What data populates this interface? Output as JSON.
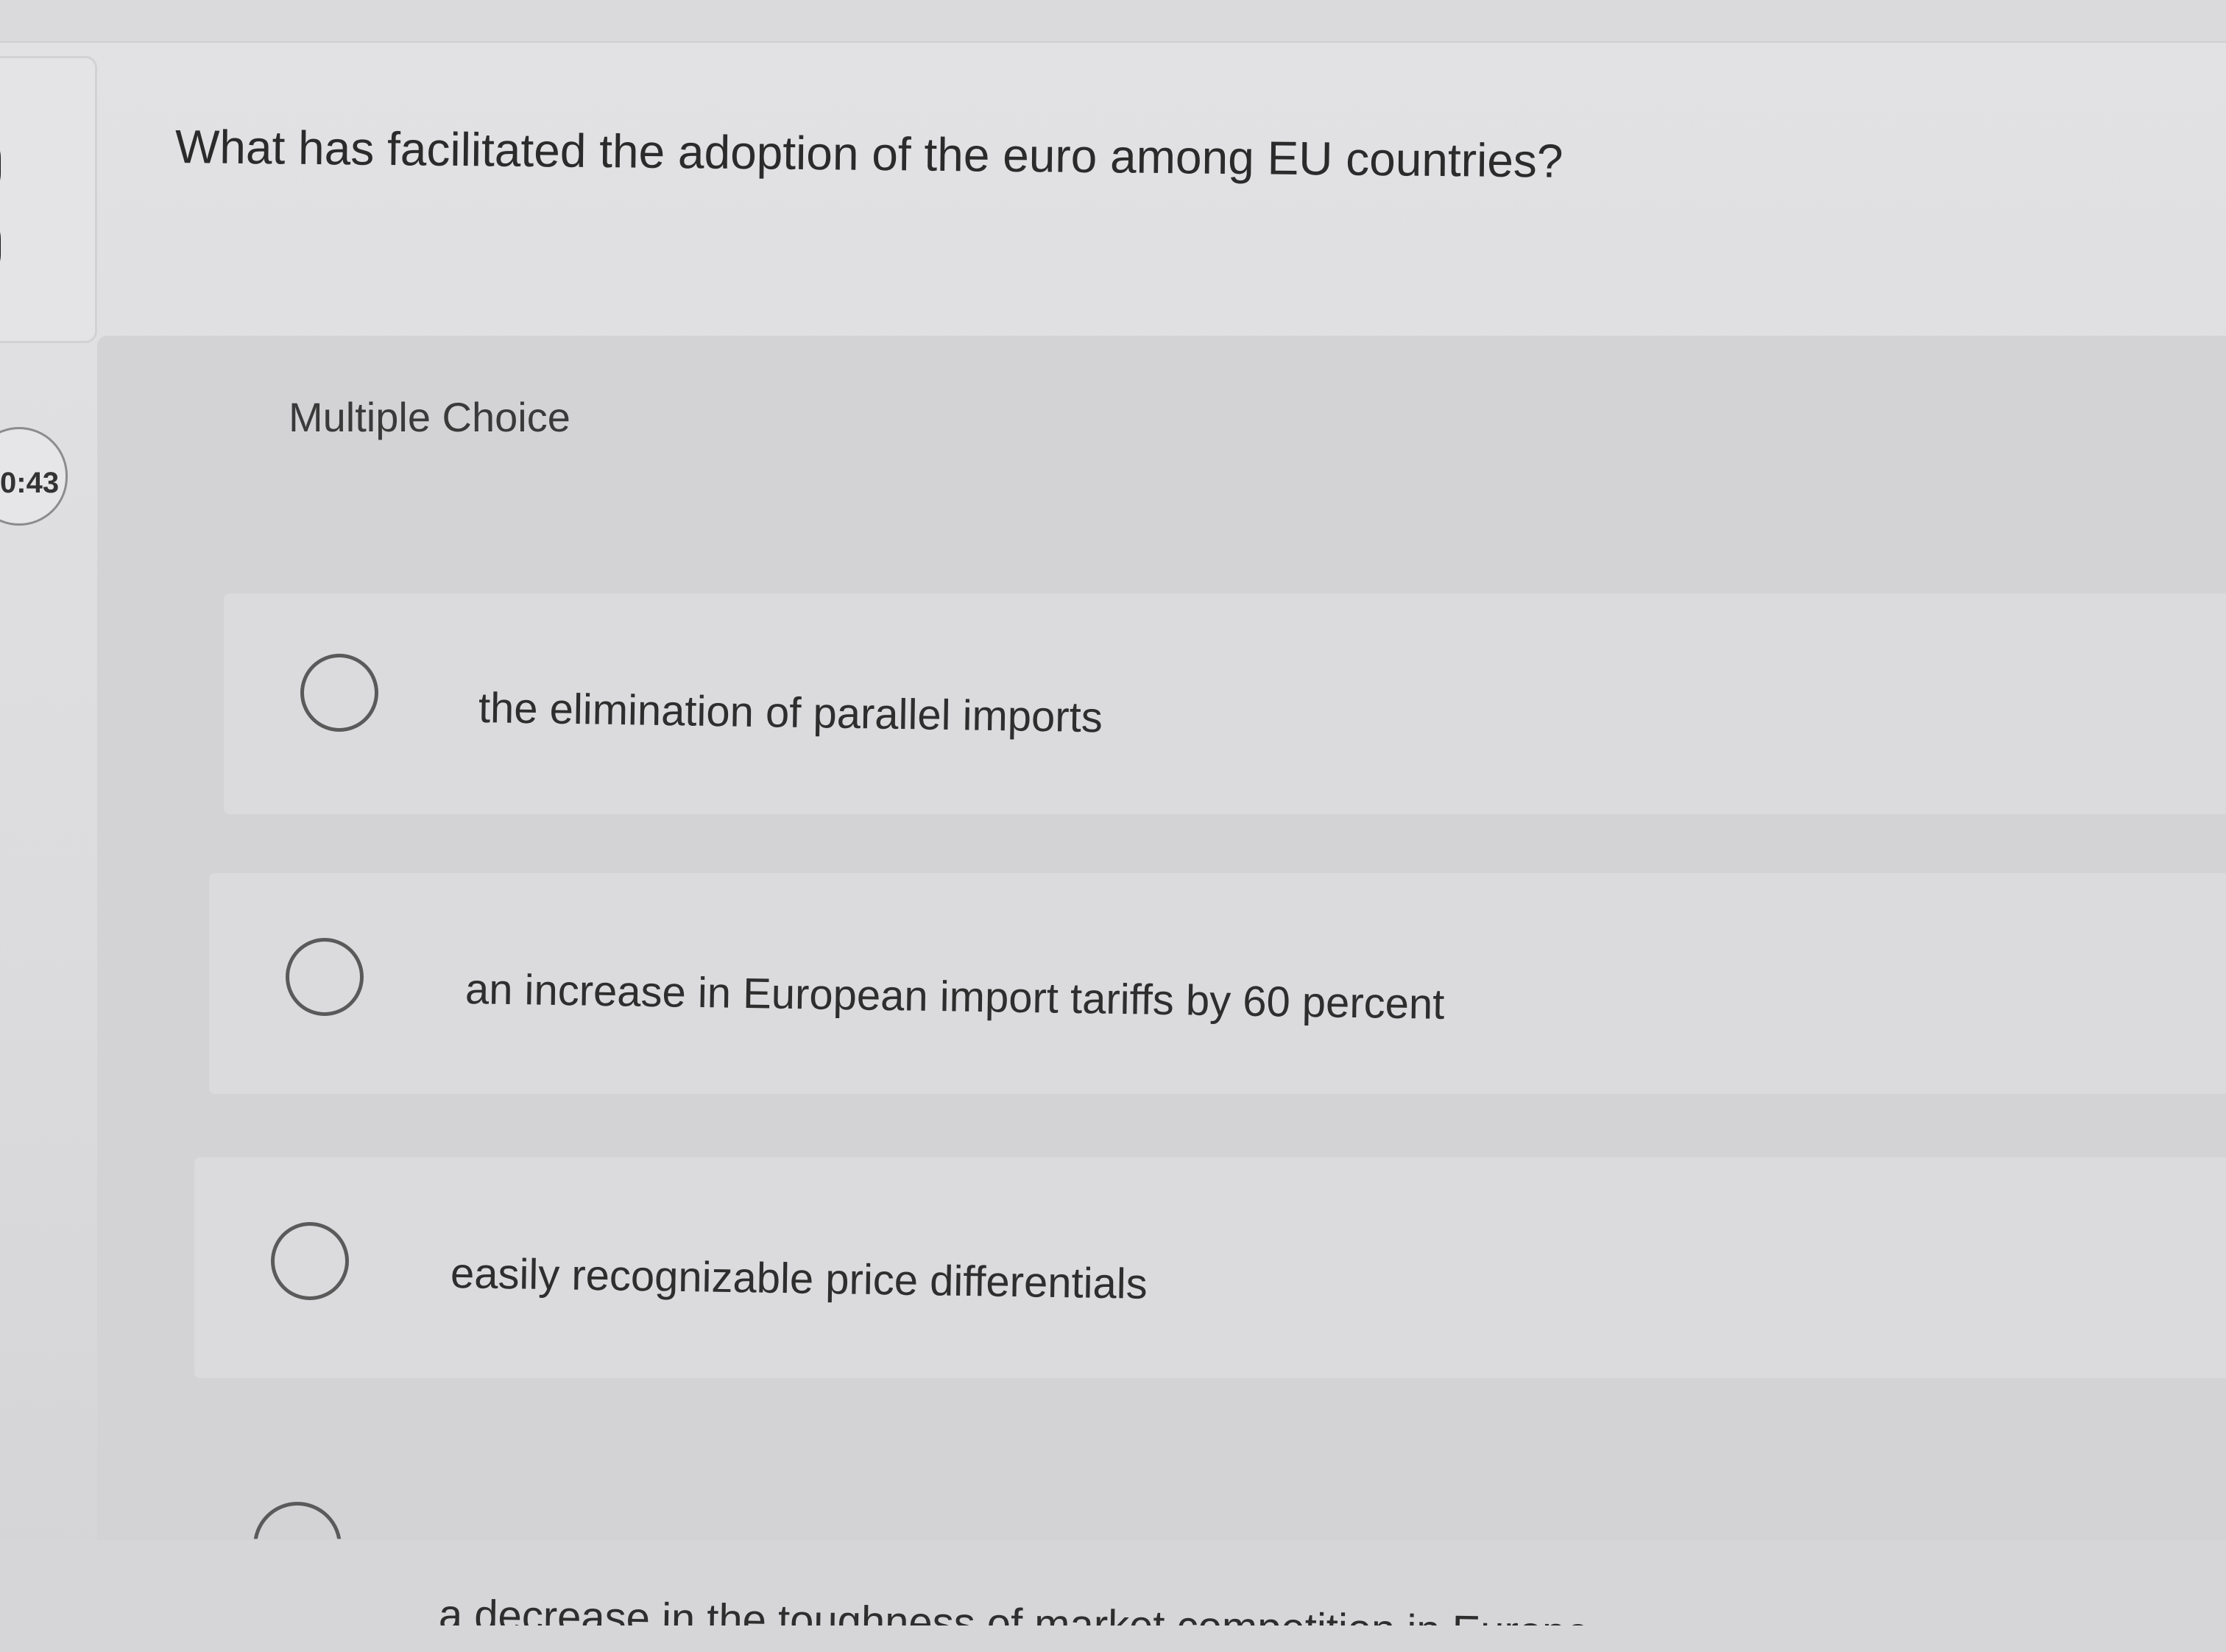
{
  "timer": {
    "text": "0:43"
  },
  "question": {
    "text": "What has facilitated the adoption of the euro among EU countries?"
  },
  "question_type": {
    "label": "Multiple Choice"
  },
  "options": [
    {
      "label": "the elimination of parallel imports",
      "selected": false
    },
    {
      "label": "an increase in European import tariffs by 60 percent",
      "selected": false
    },
    {
      "label": "easily recognizable price differentials",
      "selected": false
    },
    {
      "label": "a decrease in the toughness of market competition in Europe",
      "selected": false
    }
  ]
}
